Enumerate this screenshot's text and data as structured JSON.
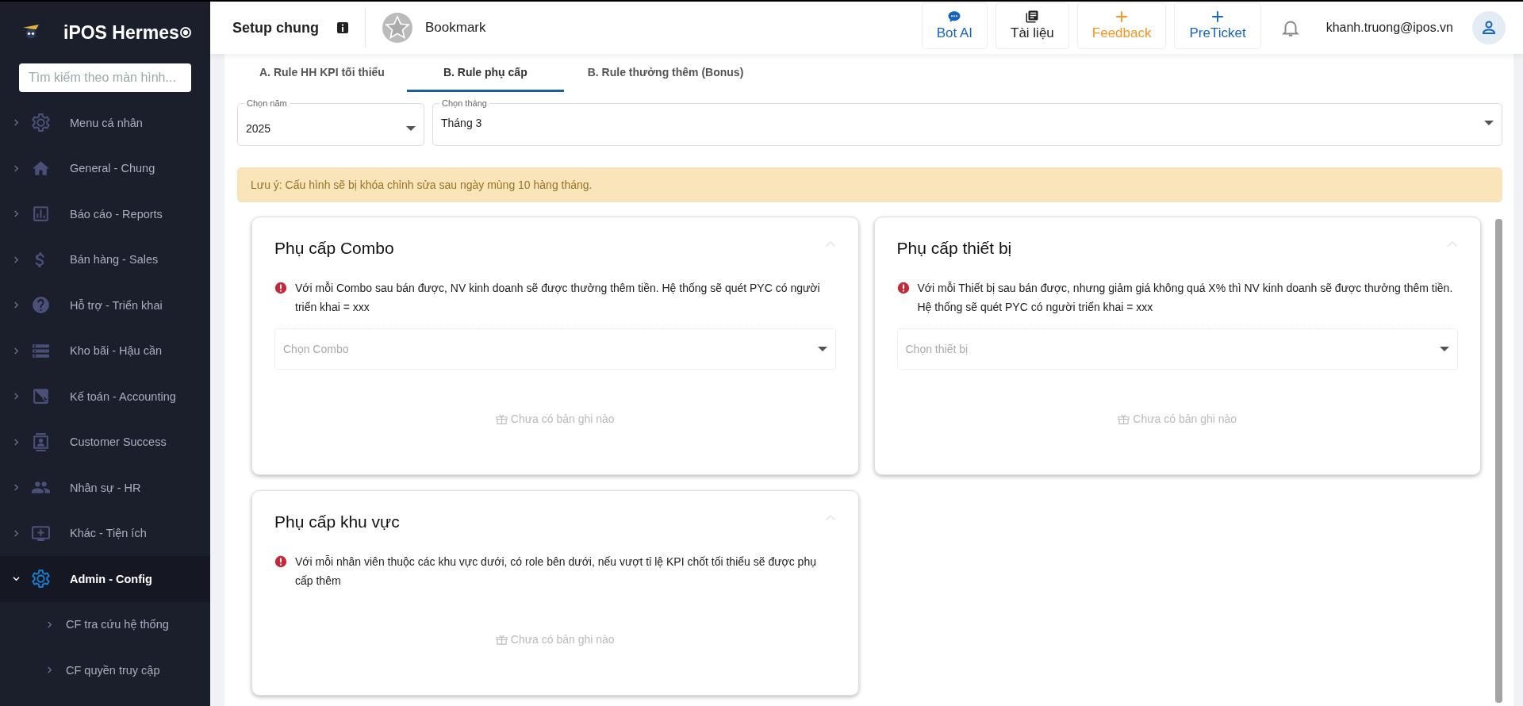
{
  "sidebar": {
    "app_name": "iPOS Hermes",
    "search": {
      "placeholder": "Tìm kiếm theo màn hình..."
    },
    "items": [
      {
        "label": "Menu cá nhân",
        "expanded": false
      },
      {
        "label": "General - Chung",
        "expanded": false
      },
      {
        "label": "Báo cáo - Reports",
        "expanded": false
      },
      {
        "label": "Bán hàng - Sales",
        "expanded": false
      },
      {
        "label": "Hỗ trợ - Triển khai",
        "expanded": false
      },
      {
        "label": "Kho bãi - Hậu cần",
        "expanded": false
      },
      {
        "label": "Kế toán - Accounting",
        "expanded": false
      },
      {
        "label": "Customer Success",
        "expanded": false
      },
      {
        "label": "Nhân sự - HR",
        "expanded": false
      },
      {
        "label": "Khác - Tiện ích",
        "expanded": false
      },
      {
        "label": "Admin - Config",
        "expanded": true,
        "children": [
          {
            "label": "CF tra cứu hệ thống"
          },
          {
            "label": "CF quyền truy cập"
          }
        ]
      }
    ]
  },
  "header": {
    "title": "Setup chung",
    "bookmark": "Bookmark",
    "buttons": [
      {
        "label": "Bot AI",
        "kind": "chat",
        "color": "#1565c0"
      },
      {
        "label": "Tài liệu",
        "kind": "book",
        "color": "#222222"
      },
      {
        "label": "Feedback",
        "kind": "plus",
        "color": "#f5931e"
      },
      {
        "label": "PreTicket",
        "kind": "plus",
        "color": "#1565c0"
      }
    ],
    "user": "khanh.truong@ipos.vn"
  },
  "tabs": [
    {
      "label": "A. Rule HH KPI tối thiểu",
      "selected": false
    },
    {
      "label": "B. Rule phụ cấp",
      "selected": true
    },
    {
      "label": "B. Rule thưởng thêm (Bonus)",
      "selected": false
    }
  ],
  "filters": [
    {
      "label": "Chọn năm",
      "value": "2025"
    },
    {
      "label": "Chọn tháng",
      "value": "Tháng 3"
    }
  ],
  "notice": "Lưu ý: Cấu hình sẽ bị khóa chỉnh sửa sau ngày mùng 10 hàng tháng.",
  "cards": [
    {
      "title": "Phụ cấp Combo",
      "note": "Với mỗi Combo sau bán được, NV kinh doanh sẽ được thưởng thêm tiền. Hệ thống sẽ quét PYC có người triển khai = xxx",
      "select": {
        "placeholder": "Chọn Combo"
      },
      "empty": "Chưa có bản ghi nào"
    },
    {
      "title": "Phụ cấp thiết bị",
      "note": "Với mỗi Thiết bị sau bán được, nhưng giảm giá không quá X% thì NV kinh doanh sẽ được thưởng thêm tiền. Hệ thống sẽ quét PYC có người triển khai = xxx",
      "select": {
        "placeholder": "Chọn thiết bị"
      },
      "empty": "Chưa có bản ghi nào"
    },
    {
      "title": "Phụ cấp khu vực",
      "note": "Với mỗi nhân viên thuộc các khu vực dưới, có role bên dưới, nếu vượt tỉ lệ KPI chốt tối thiểu sẽ được phụ cấp thêm",
      "empty": "Chưa có bản ghi nào"
    }
  ]
}
